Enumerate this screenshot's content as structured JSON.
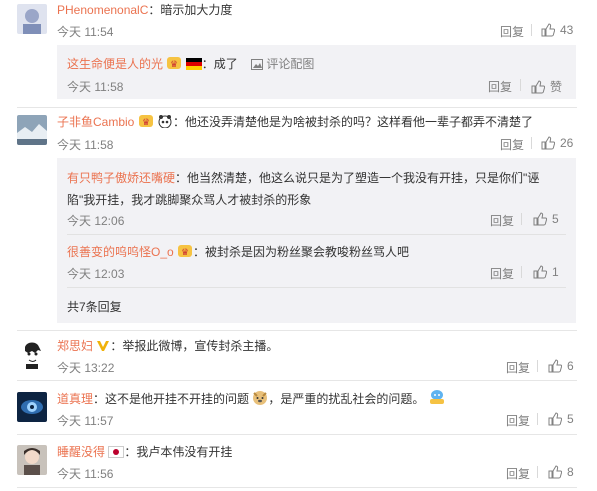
{
  "comments": [
    {
      "user": "PHenomenonalC",
      "text": "：暗示加大力度",
      "time": "今天 11:54",
      "reply": "回复",
      "likes": "43"
    },
    {
      "user": "子非鱼Cambio",
      "text": "：他还没弄清楚他是为啥被封杀的吗？这样看他一辈子都弄不清楚了",
      "time": "今天 11:58",
      "reply": "回复",
      "likes": "26"
    },
    {
      "user": "郑思妇",
      "text": "：举报此微博，宣传封杀主播。",
      "time": "今天 13:22",
      "reply": "回复",
      "likes": "6"
    },
    {
      "user": "道真理",
      "text": "：这不是他开挂不开挂的问题",
      "text2": "，是严重的扰乱社会的问题。",
      "time": "今天 11:57",
      "reply": "回复",
      "likes": "5"
    },
    {
      "user": "睡醒没得",
      "text": "：我卢本伟没有开挂",
      "time": "今天 11:56",
      "reply": "回复",
      "likes": "8"
    }
  ],
  "sub1": {
    "user": "这生命便是人的光",
    "text": "：成了",
    "pic_link": "评论配图",
    "time": "今天 11:58",
    "reply": "回复",
    "likes": "赞"
  },
  "sub2": [
    {
      "user": "有只鸭子傲娇还嘴硬",
      "line1": "：他当然清楚，他这么说只是为了塑造一个我没有开挂，只是你们\"诬",
      "line2": "陷\"我开挂，我才跳脚聚众骂人才被封杀的形象",
      "time": "今天 12:06",
      "reply": "回复",
      "likes": "5"
    },
    {
      "user": "很善变的呜呜怪O_o",
      "text": "：被封杀是因为粉丝聚会教唆粉丝骂人吧",
      "time": "今天 12:03",
      "reply": "回复",
      "likes": "1"
    }
  ],
  "more_replies": "共7条回复",
  "colors": {
    "name": "#eb7350",
    "link": "#eb7350",
    "text": "#333333",
    "muted": "#808080",
    "subbox": "#f2f2f5"
  }
}
